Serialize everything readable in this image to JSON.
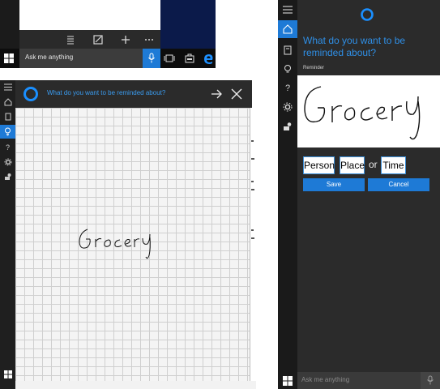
{
  "taskbar": {
    "search_placeholder": "Ask me anything"
  },
  "ink_window": {
    "prompt": "What do you want to be reminded about?"
  },
  "reminder_panel": {
    "question": "What do you want to be reminded about?",
    "section_label": "Reminder",
    "chips": {
      "person": "Person",
      "place": "Place",
      "or": "or",
      "time": "Time"
    },
    "save_label": "Save",
    "cancel_label": "Cancel",
    "search_placeholder": "Ask me anything"
  },
  "handwriting": "Grocery",
  "colors": {
    "accent": "#1e7ad6",
    "cortana_blue": "#1a8fff",
    "dark_bg": "#2b2b2b"
  }
}
